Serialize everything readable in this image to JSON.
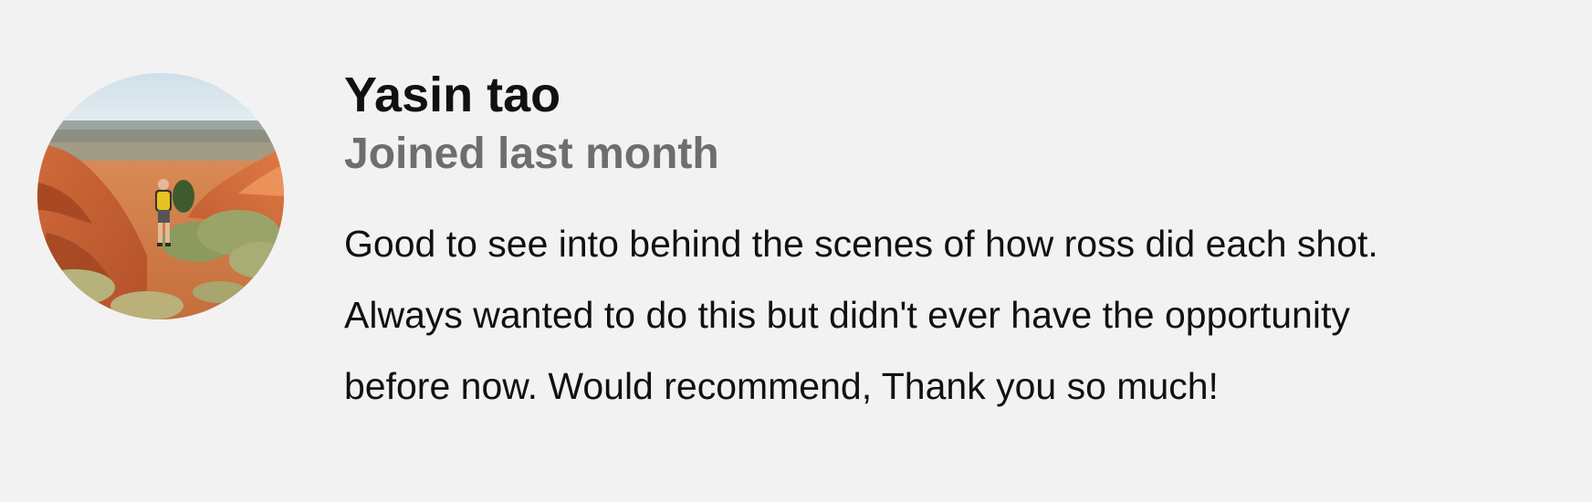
{
  "review": {
    "author_name": "Yasin tao",
    "joined": "Joined last month",
    "text_lines": [
      "Good to see into behind the scenes of how ross did each shot.",
      "Always wanted to do this but didn't ever have the opportunity",
      "before now. Would recommend, Thank you so much!"
    ],
    "avatar": {
      "icon": "profile-photo-hiker-in-canyon"
    }
  }
}
